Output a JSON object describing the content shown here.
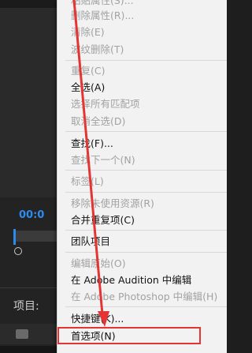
{
  "app": {
    "timecode": "00:0",
    "project_label": "项目:",
    "bin_label": "..."
  },
  "menu": {
    "items": [
      {
        "label": "粘贴属性(S)...",
        "enabled": false
      },
      {
        "label": "删除属性(R)...",
        "enabled": false
      },
      {
        "label": "清除(E)",
        "enabled": false
      },
      {
        "label": "波纹删除(T)",
        "enabled": false
      },
      {
        "label": "重复(C)",
        "enabled": false
      },
      {
        "label": "全选(A)",
        "enabled": true
      },
      {
        "label": "选择所有匹配项",
        "enabled": false
      },
      {
        "label": "取消全选(D)",
        "enabled": false
      },
      {
        "label": "查找(F)...",
        "enabled": true
      },
      {
        "label": "查找下一个(N)",
        "enabled": false
      },
      {
        "label": "标签(L)",
        "enabled": false
      },
      {
        "label": "移除未使用资源(R)",
        "enabled": false
      },
      {
        "label": "合并重复项(C)",
        "enabled": true
      },
      {
        "label": "团队项目",
        "enabled": true
      },
      {
        "label": "编辑原始(O)",
        "enabled": false
      },
      {
        "label": "在 Adobe Audition 中编辑",
        "enabled": true
      },
      {
        "label": "在 Adobe Photoshop 中编辑(H)",
        "enabled": false
      },
      {
        "label": "快捷键(K)...",
        "enabled": true
      },
      {
        "label": "首选项(N)",
        "enabled": true
      }
    ]
  },
  "annotation": {
    "arrow_color": "#e53434",
    "highlight_color": "#e53434"
  }
}
